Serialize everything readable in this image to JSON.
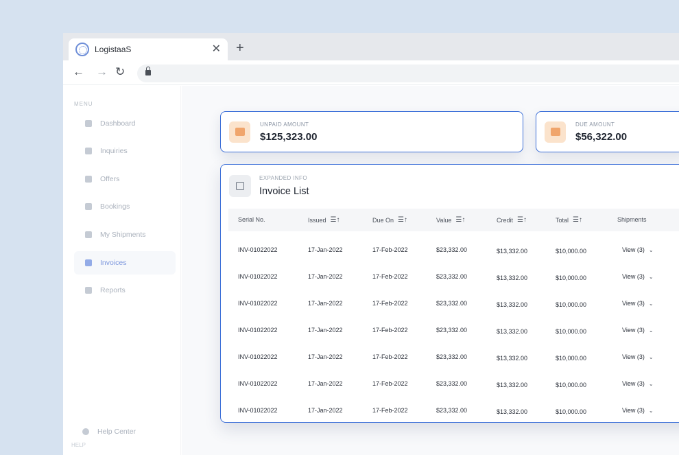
{
  "browser": {
    "tab_title": "LogistaaS",
    "tab_close": "✕",
    "new_tab": "+",
    "back": "←",
    "forward": "→",
    "reload": "↻"
  },
  "sidebar": {
    "menu_label": "MENU",
    "items": [
      {
        "label": "Dashboard"
      },
      {
        "label": "Inquiries"
      },
      {
        "label": "Offers"
      },
      {
        "label": "Bookings"
      },
      {
        "label": "My Shipments"
      },
      {
        "label": "Invoices"
      },
      {
        "label": "Reports"
      }
    ],
    "active_item": "Invoices",
    "help_section": "HELP",
    "help_item": "Help Center"
  },
  "stats": {
    "unpaid": {
      "label": "UNPAID AMOUNT",
      "value": "$125,323.00"
    },
    "due": {
      "label": "DUE AMOUNT",
      "value": "$56,322.00"
    }
  },
  "invoice_list": {
    "caption": "EXPANDED INFO",
    "title": "Invoice List",
    "sort_glyph": "☰↑",
    "columns": [
      "Serial No.",
      "Issued",
      "Due On",
      "Value",
      "Credit",
      "Total",
      "Shipments"
    ],
    "rows": [
      {
        "serial": "INV-01022022",
        "issued": "17-Jan-2022",
        "due": "17-Feb-2022",
        "value": "$23,332.00",
        "credit": "$13,332.00",
        "total": "$10,000.00",
        "shipments": "View (3)"
      },
      {
        "serial": "INV-01022022",
        "issued": "17-Jan-2022",
        "due": "17-Feb-2022",
        "value": "$23,332.00",
        "credit": "$13,332.00",
        "total": "$10,000.00",
        "shipments": "View (3)"
      },
      {
        "serial": "INV-01022022",
        "issued": "17-Jan-2022",
        "due": "17-Feb-2022",
        "value": "$23,332.00",
        "credit": "$13,332.00",
        "total": "$10,000.00",
        "shipments": "View (3)"
      },
      {
        "serial": "INV-01022022",
        "issued": "17-Jan-2022",
        "due": "17-Feb-2022",
        "value": "$23,332.00",
        "credit": "$13,332.00",
        "total": "$10,000.00",
        "shipments": "View (3)"
      },
      {
        "serial": "INV-01022022",
        "issued": "17-Jan-2022",
        "due": "17-Feb-2022",
        "value": "$23,332.00",
        "credit": "$13,332.00",
        "total": "$10,000.00",
        "shipments": "View (3)"
      },
      {
        "serial": "INV-01022022",
        "issued": "17-Jan-2022",
        "due": "17-Feb-2022",
        "value": "$23,332.00",
        "credit": "$13,332.00",
        "total": "$10,000.00",
        "shipments": "View (3)"
      },
      {
        "serial": "INV-01022022",
        "issued": "17-Jan-2022",
        "due": "17-Feb-2022",
        "value": "$23,332.00",
        "credit": "$13,332.00",
        "total": "$10,000.00",
        "shipments": "View (3)"
      }
    ],
    "chevron": "⌄"
  },
  "colors": {
    "accent_border": "#3c6fd8",
    "stat_icon_bg": "#fbe3cc",
    "active_nav": "#4a6fd1"
  }
}
